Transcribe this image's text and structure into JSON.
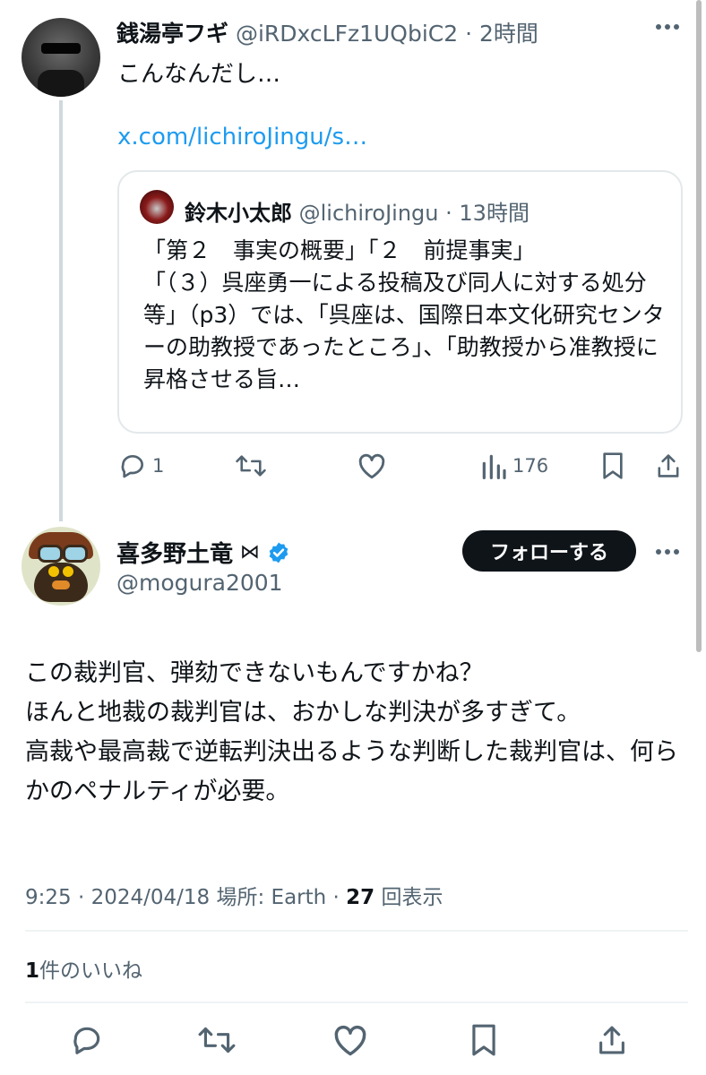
{
  "quoting_tweet": {
    "display_name": "銭湯亭フギ",
    "handle": "@iRDxcLFz1UQbiC2",
    "sep": "·",
    "time": "2時間",
    "text": "こんなんだし…",
    "link": "x.com/lichiroJingu/s…",
    "more_icon": "more-dots-icon"
  },
  "quoted_tweet": {
    "display_name": "鈴木小太郎",
    "handle": "@lichiroJingu",
    "sep": "·",
    "time": "13時間",
    "text": "「第２　事実の概要」「２　前提事実」\n「（３）呉座勇一による投稿及び同人に対する処分等」（p3）では、「呉座は、国際日本文化研究センターの助教授であったところ」、「助教授から准教授に昇格させる旨…"
  },
  "quoting_actions": {
    "reply_count": "1",
    "views_count": "176",
    "icons": [
      "reply-icon",
      "retweet-icon",
      "like-icon",
      "views-icon",
      "bookmark-icon",
      "share-icon"
    ]
  },
  "main_tweet": {
    "display_name": "喜多野土竜",
    "name_symbol": "⋈",
    "handle": "@mogura2001",
    "follow_label": "フォローする",
    "text": "この裁判官、弾劾できないもんですかね？\nほんと地裁の裁判官は、おかしな判決が多すぎて。\n高裁や最高裁で逆転判決出るような判断した裁判官は、何らかのペナルティが必要。",
    "time": "9:25",
    "date": "2024/04/18",
    "location_label": "場所: Earth",
    "views_number": "27",
    "views_label": "回表示",
    "likes_number": "1",
    "likes_label": "件のいいね",
    "verified_color": "#1d9bf0"
  },
  "dot_sep": "·"
}
